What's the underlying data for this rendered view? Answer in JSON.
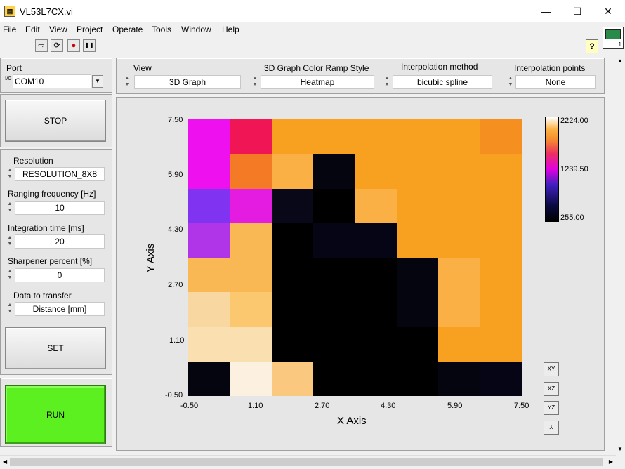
{
  "window": {
    "title": "VL53L7CX.vi",
    "minimize": "—",
    "maximize": "☐",
    "close": "✕",
    "vi_icon_number": "1"
  },
  "menu": [
    "File",
    "Edit",
    "View",
    "Project",
    "Operate",
    "Tools",
    "Window",
    "Help"
  ],
  "toolbar": {
    "run": "⇨",
    "continuous": "⟳",
    "abort": "●",
    "pause": "❚❚",
    "help": "?"
  },
  "port": {
    "label": "Port",
    "prefix": "I/0",
    "value": "COM10"
  },
  "stop_label": "STOP",
  "settings": {
    "resolution": {
      "label": "Resolution",
      "value": "RESOLUTION_8X8"
    },
    "ranging": {
      "label": "Ranging frequency [Hz]",
      "value": "10"
    },
    "integration": {
      "label": "Integration time [ms]",
      "value": "20"
    },
    "sharpener": {
      "label": "Sharpener percent [%]",
      "value": "0"
    },
    "transfer": {
      "label": "Data to transfer",
      "value": "Distance [mm]"
    }
  },
  "set_label": "SET",
  "run_label": "RUN",
  "controls": {
    "view": {
      "label": "View",
      "value": "3D Graph"
    },
    "ramp": {
      "label": "3D Graph Color Ramp Style",
      "value": "Heatmap"
    },
    "interp_method": {
      "label": "Interpolation method",
      "value": "bicubic spline"
    },
    "interp_points": {
      "label": "Interpolation points",
      "value": "None"
    }
  },
  "graph": {
    "x_label": "X Axis",
    "y_label": "Y Axis",
    "x_ticks": [
      "-0.50",
      "1.10",
      "2.70",
      "4.30",
      "5.90",
      "7.50"
    ],
    "y_ticks": [
      "7.50",
      "5.90",
      "4.30",
      "2.70",
      "1.10",
      "-0.50"
    ],
    "colorbar_ticks": [
      "2224.00",
      "1239.50",
      "255.00"
    ]
  },
  "chart_data": {
    "type": "heatmap",
    "xlabel": "X Axis",
    "ylabel": "Y Axis",
    "xlim": [
      -0.5,
      7.5
    ],
    "ylim": [
      -0.5,
      7.5
    ],
    "zlim": [
      255.0,
      2224.0
    ],
    "colorbar_ticks": [
      2224.0,
      1239.5,
      255.0
    ],
    "rows_top_to_bottom": [
      [
        "#ee10ee",
        "#f01555",
        "#f8a020",
        "#f8a020",
        "#f8a020",
        "#f8a020",
        "#f8a020",
        "#f59020"
      ],
      [
        "#ee10ee",
        "#f57a25",
        "#fab045",
        "#050510",
        "#f8a020",
        "#f8a020",
        "#f8a020",
        "#f8a020"
      ],
      [
        "#8033f0",
        "#e41be0",
        "#080818",
        "#000000",
        "#fab045",
        "#f8a020",
        "#f8a020",
        "#f8a020"
      ],
      [
        "#b034e8",
        "#fab855",
        "#000000",
        "#050515",
        "#050515",
        "#f8a020",
        "#f8a020",
        "#f8a020"
      ],
      [
        "#fab855",
        "#fab855",
        "#000000",
        "#000000",
        "#000000",
        "#050510",
        "#fab045",
        "#f8a020"
      ],
      [
        "#f9d7a0",
        "#fbc870",
        "#000000",
        "#000000",
        "#000000",
        "#050510",
        "#fab045",
        "#f8a020"
      ],
      [
        "#fadfb0",
        "#fadfb0",
        "#000000",
        "#000000",
        "#000000",
        "#000000",
        "#f8a020",
        "#f8a020"
      ],
      [
        "#050510",
        "#fcf0e0",
        "#fbc880",
        "#000000",
        "#000000",
        "#000000",
        "#050510",
        "#050515"
      ]
    ]
  }
}
